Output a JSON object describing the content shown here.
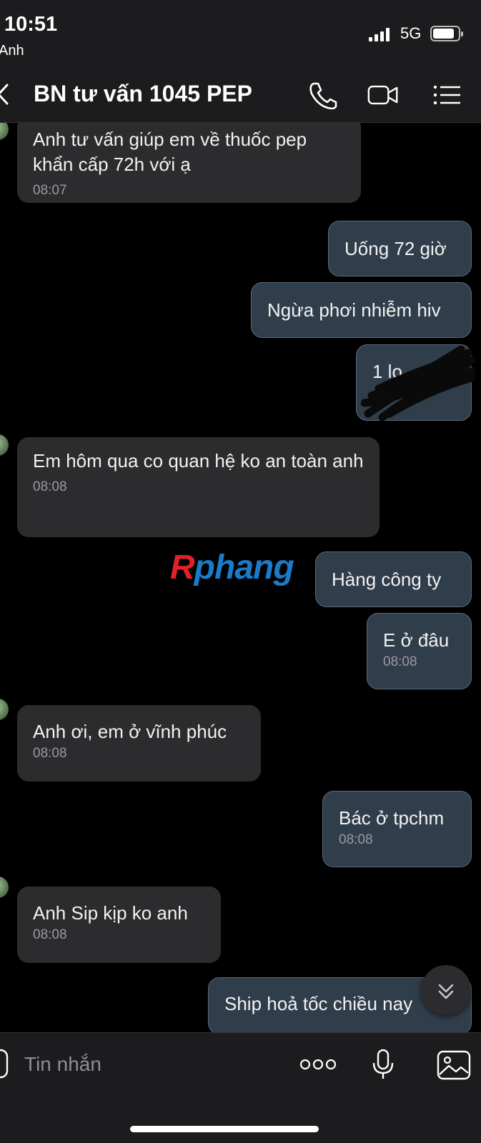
{
  "status_bar": {
    "time": "10:51",
    "back_app": "Anh",
    "network": "5G",
    "battery_level": 0.85
  },
  "header": {
    "title": "BN tư vấn 1045 PEP",
    "icons": [
      "back-chevron-icon",
      "phone-icon",
      "video-call-icon",
      "menu-list-icon"
    ]
  },
  "messages": [
    {
      "dir": "in",
      "text": "Anh tư vấn giúp em về thuốc pep khẩn cấp 72h với ạ",
      "time": "08:07"
    },
    {
      "dir": "out",
      "text": "Uống 72 giờ"
    },
    {
      "dir": "out",
      "text": "Ngừa phơi nhiễm hiv"
    },
    {
      "dir": "out",
      "text": "1 lọ"
    },
    {
      "dir": "in",
      "text": "Em hôm qua co quan hệ ko an toàn anh",
      "time": "08:08"
    },
    {
      "dir": "out",
      "text": "Hàng công ty"
    },
    {
      "dir": "out",
      "text": "E ở đâu",
      "time": "08:08"
    },
    {
      "dir": "in",
      "text": "Anh ơi, em ở vĩnh phúc",
      "time": "08:08"
    },
    {
      "dir": "out",
      "text": "Bác ở tpchm",
      "time": "08:08"
    },
    {
      "dir": "in",
      "text": "Anh Sip kịp ko anh",
      "time": "08:08"
    },
    {
      "dir": "out",
      "text": "Ship hoả tốc chiều nay"
    }
  ],
  "watermark": {
    "first": "R",
    "rest": "phang"
  },
  "composer": {
    "placeholder": "Tin nhắn",
    "icons": [
      "attach-icon",
      "more-dots-icon",
      "microphone-icon",
      "image-icon"
    ]
  },
  "colors": {
    "background": "#000000",
    "bar": "#1c1c1e",
    "incoming_bubble": "#2c2c2e",
    "outgoing_bubble": "#303d4a",
    "outgoing_border": "#5a6a7a",
    "timestamp": "#9a9a9e"
  }
}
